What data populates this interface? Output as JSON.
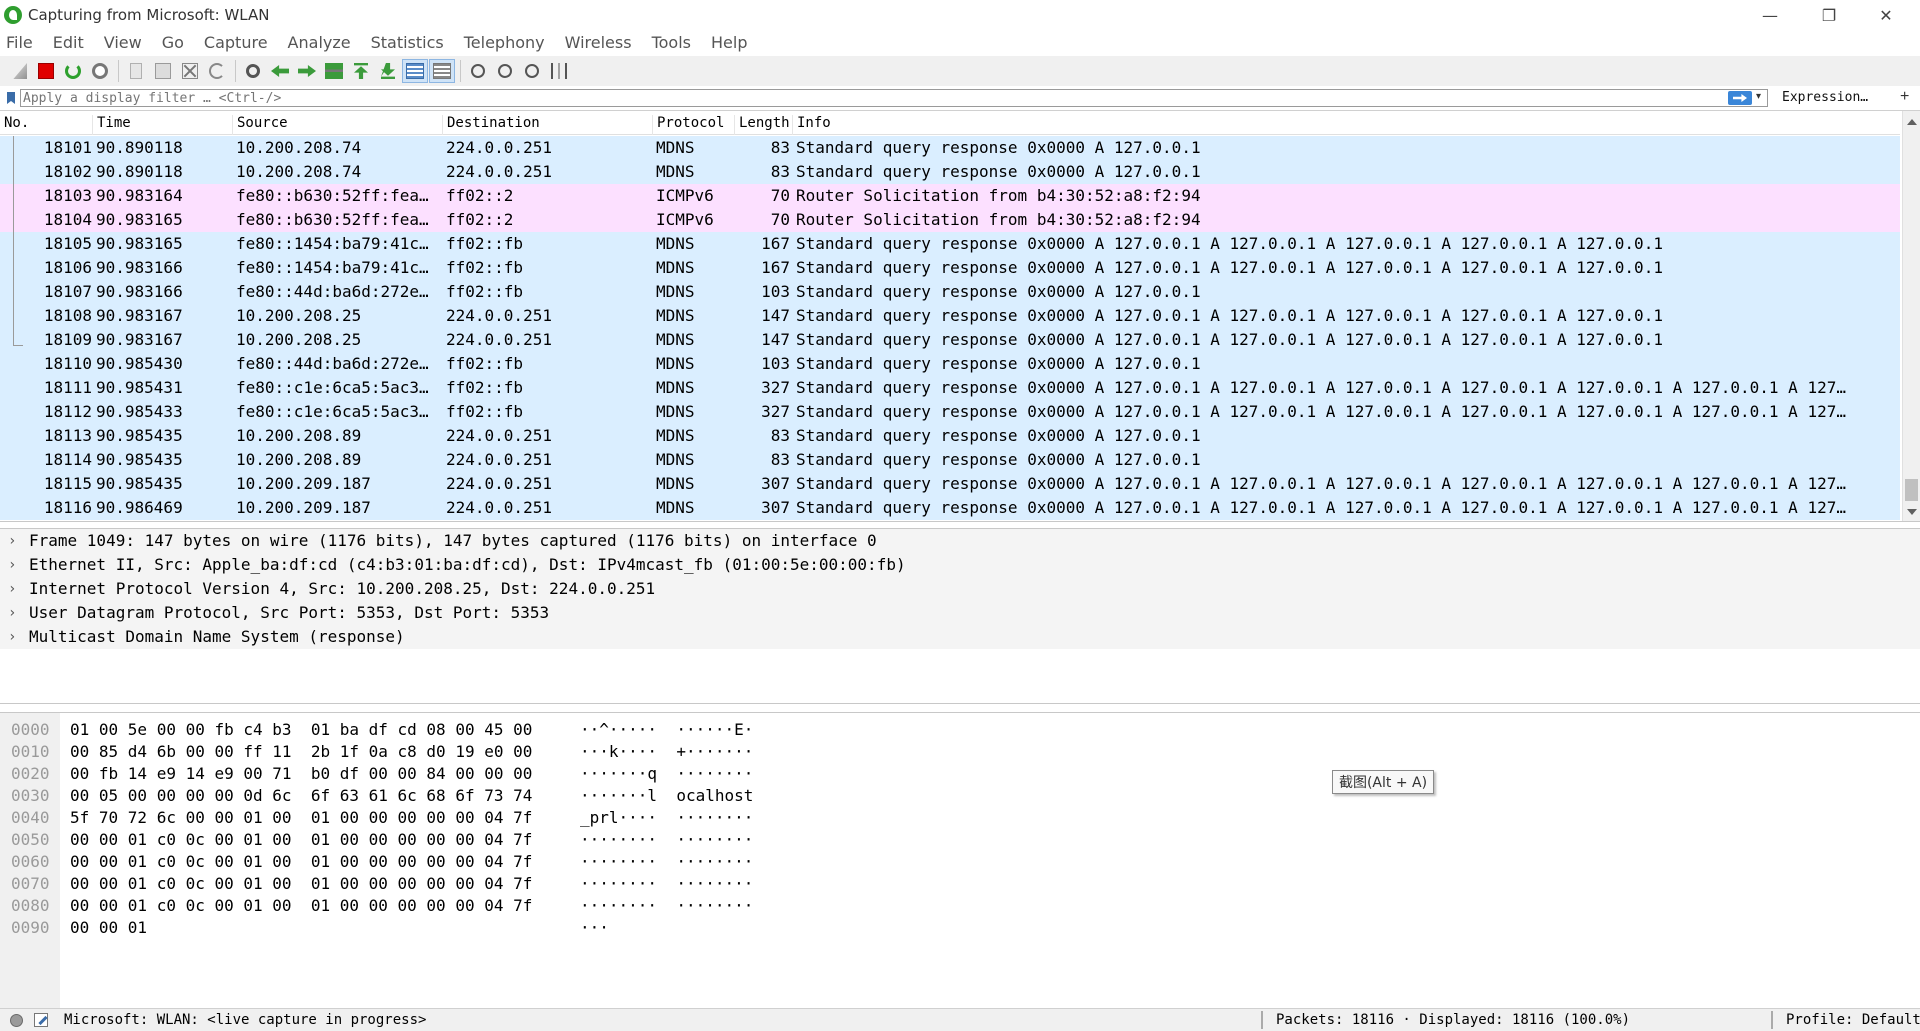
{
  "window": {
    "title": "Capturing from Microsoft: WLAN",
    "minimize_glyph": "—",
    "maximize_glyph": "❐",
    "close_glyph": "✕"
  },
  "menu": [
    "File",
    "Edit",
    "View",
    "Go",
    "Capture",
    "Analyze",
    "Statistics",
    "Telephony",
    "Wireless",
    "Tools",
    "Help"
  ],
  "toolbar": {
    "icons": [
      "shark-fin-icon",
      "stop-capture-icon",
      "restart-capture-icon",
      "capture-options-icon",
      "open-file-icon",
      "save-file-icon",
      "close-file-icon",
      "reload-file-icon",
      "find-packet-icon",
      "go-back-icon",
      "go-forward-icon",
      "go-to-packet-icon",
      "first-packet-icon",
      "last-packet-icon",
      "auto-scroll-icon",
      "colorize-icon",
      "zoom-in-icon",
      "zoom-out-icon",
      "zoom-normal-icon",
      "resize-columns-icon"
    ]
  },
  "filter": {
    "placeholder": "Apply a display filter … <Ctrl-/>",
    "expression_label": "Expression…",
    "add_label": "+",
    "dropdown_glyph": "▾"
  },
  "packet_list": {
    "columns": [
      "No.",
      "Time",
      "Source",
      "Destination",
      "Protocol",
      "Length",
      "Info"
    ],
    "rows": [
      {
        "no": "18101",
        "time": "90.890118",
        "src": "10.200.208.74",
        "dst": "224.0.0.251",
        "proto": "MDNS",
        "len": "83",
        "info": "Standard query response 0x0000 A 127.0.0.1",
        "color": "mdns"
      },
      {
        "no": "18102",
        "time": "90.890118",
        "src": "10.200.208.74",
        "dst": "224.0.0.251",
        "proto": "MDNS",
        "len": "83",
        "info": "Standard query response 0x0000 A 127.0.0.1",
        "color": "mdns"
      },
      {
        "no": "18103",
        "time": "90.983164",
        "src": "fe80::b630:52ff:fea…",
        "dst": "ff02::2",
        "proto": "ICMPv6",
        "len": "70",
        "info": "Router Solicitation from b4:30:52:a8:f2:94",
        "color": "icmp"
      },
      {
        "no": "18104",
        "time": "90.983165",
        "src": "fe80::b630:52ff:fea…",
        "dst": "ff02::2",
        "proto": "ICMPv6",
        "len": "70",
        "info": "Router Solicitation from b4:30:52:a8:f2:94",
        "color": "icmp"
      },
      {
        "no": "18105",
        "time": "90.983165",
        "src": "fe80::1454:ba79:41c…",
        "dst": "ff02::fb",
        "proto": "MDNS",
        "len": "167",
        "info": "Standard query response 0x0000 A 127.0.0.1 A 127.0.0.1 A 127.0.0.1 A 127.0.0.1 A 127.0.0.1",
        "color": "mdns"
      },
      {
        "no": "18106",
        "time": "90.983166",
        "src": "fe80::1454:ba79:41c…",
        "dst": "ff02::fb",
        "proto": "MDNS",
        "len": "167",
        "info": "Standard query response 0x0000 A 127.0.0.1 A 127.0.0.1 A 127.0.0.1 A 127.0.0.1 A 127.0.0.1",
        "color": "mdns"
      },
      {
        "no": "18107",
        "time": "90.983166",
        "src": "fe80::44d:ba6d:272e…",
        "dst": "ff02::fb",
        "proto": "MDNS",
        "len": "103",
        "info": "Standard query response 0x0000 A 127.0.0.1",
        "color": "mdns"
      },
      {
        "no": "18108",
        "time": "90.983167",
        "src": "10.200.208.25",
        "dst": "224.0.0.251",
        "proto": "MDNS",
        "len": "147",
        "info": "Standard query response 0x0000 A 127.0.0.1 A 127.0.0.1 A 127.0.0.1 A 127.0.0.1 A 127.0.0.1",
        "color": "mdns"
      },
      {
        "no": "18109",
        "time": "90.983167",
        "src": "10.200.208.25",
        "dst": "224.0.0.251",
        "proto": "MDNS",
        "len": "147",
        "info": "Standard query response 0x0000 A 127.0.0.1 A 127.0.0.1 A 127.0.0.1 A 127.0.0.1 A 127.0.0.1",
        "color": "mdns"
      },
      {
        "no": "18110",
        "time": "90.985430",
        "src": "fe80::44d:ba6d:272e…",
        "dst": "ff02::fb",
        "proto": "MDNS",
        "len": "103",
        "info": "Standard query response 0x0000 A 127.0.0.1",
        "color": "mdns"
      },
      {
        "no": "18111",
        "time": "90.985431",
        "src": "fe80::c1e:6ca5:5ac3…",
        "dst": "ff02::fb",
        "proto": "MDNS",
        "len": "327",
        "info": "Standard query response 0x0000 A 127.0.0.1 A 127.0.0.1 A 127.0.0.1 A 127.0.0.1 A 127.0.0.1 A 127.0.0.1 A 127…",
        "color": "mdns"
      },
      {
        "no": "18112",
        "time": "90.985433",
        "src": "fe80::c1e:6ca5:5ac3…",
        "dst": "ff02::fb",
        "proto": "MDNS",
        "len": "327",
        "info": "Standard query response 0x0000 A 127.0.0.1 A 127.0.0.1 A 127.0.0.1 A 127.0.0.1 A 127.0.0.1 A 127.0.0.1 A 127…",
        "color": "mdns"
      },
      {
        "no": "18113",
        "time": "90.985435",
        "src": "10.200.208.89",
        "dst": "224.0.0.251",
        "proto": "MDNS",
        "len": "83",
        "info": "Standard query response 0x0000 A 127.0.0.1",
        "color": "mdns"
      },
      {
        "no": "18114",
        "time": "90.985435",
        "src": "10.200.208.89",
        "dst": "224.0.0.251",
        "proto": "MDNS",
        "len": "83",
        "info": "Standard query response 0x0000 A 127.0.0.1",
        "color": "mdns"
      },
      {
        "no": "18115",
        "time": "90.985435",
        "src": "10.200.209.187",
        "dst": "224.0.0.251",
        "proto": "MDNS",
        "len": "307",
        "info": "Standard query response 0x0000 A 127.0.0.1 A 127.0.0.1 A 127.0.0.1 A 127.0.0.1 A 127.0.0.1 A 127.0.0.1 A 127…",
        "color": "mdns"
      },
      {
        "no": "18116",
        "time": "90.986469",
        "src": "10.200.209.187",
        "dst": "224.0.0.251",
        "proto": "MDNS",
        "len": "307",
        "info": "Standard query response 0x0000 A 127.0.0.1 A 127.0.0.1 A 127.0.0.1 A 127.0.0.1 A 127.0.0.1 A 127.0.0.1 A 127…",
        "color": "mdns"
      }
    ]
  },
  "details": [
    "Frame 1049: 147 bytes on wire (1176 bits), 147 bytes captured (1176 bits) on interface 0",
    "Ethernet II, Src: Apple_ba:df:cd (c4:b3:01:ba:df:cd), Dst: IPv4mcast_fb (01:00:5e:00:00:fb)",
    "Internet Protocol Version 4, Src: 10.200.208.25, Dst: 224.0.0.251",
    "User Datagram Protocol, Src Port: 5353, Dst Port: 5353",
    "Multicast Domain Name System (response)"
  ],
  "hex": [
    {
      "offset": "0000",
      "bytes": "01 00 5e 00 00 fb c4 b3  01 ba df cd 08 00 45 00",
      "ascii": "··^·····  ······E·"
    },
    {
      "offset": "0010",
      "bytes": "00 85 d4 6b 00 00 ff 11  2b 1f 0a c8 d0 19 e0 00",
      "ascii": "···k····  +·······"
    },
    {
      "offset": "0020",
      "bytes": "00 fb 14 e9 14 e9 00 71  b0 df 00 00 84 00 00 00",
      "ascii": "·······q  ········"
    },
    {
      "offset": "0030",
      "bytes": "00 05 00 00 00 00 0d 6c  6f 63 61 6c 68 6f 73 74",
      "ascii": "·······l  ocalhost"
    },
    {
      "offset": "0040",
      "bytes": "5f 70 72 6c 00 00 01 00  01 00 00 00 00 00 04 7f",
      "ascii": "_prl····  ········"
    },
    {
      "offset": "0050",
      "bytes": "00 00 01 c0 0c 00 01 00  01 00 00 00 00 00 04 7f",
      "ascii": "········  ········"
    },
    {
      "offset": "0060",
      "bytes": "00 00 01 c0 0c 00 01 00  01 00 00 00 00 00 04 7f",
      "ascii": "········  ········"
    },
    {
      "offset": "0070",
      "bytes": "00 00 01 c0 0c 00 01 00  01 00 00 00 00 00 04 7f",
      "ascii": "········  ········"
    },
    {
      "offset": "0080",
      "bytes": "00 00 01 c0 0c 00 01 00  01 00 00 00 00 00 04 7f",
      "ascii": "········  ········"
    },
    {
      "offset": "0090",
      "bytes": "00 00 01",
      "ascii": "···"
    }
  ],
  "tooltip": "截图(Alt + A)",
  "status": {
    "capture": "Microsoft: WLAN: <live capture in progress>",
    "packets": "Packets: 18116 · Displayed: 18116 (100.0%)",
    "profile": "Profile: Default"
  },
  "colors": {
    "mdns_row": "#daeeff",
    "icmp_row": "#fce0ff",
    "accent": "#3a86d8"
  }
}
